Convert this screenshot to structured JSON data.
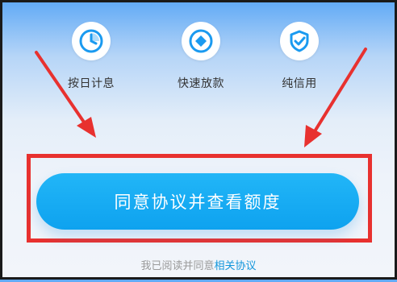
{
  "features": [
    {
      "label": "按日计息",
      "icon": "clock-icon"
    },
    {
      "label": "快速放款",
      "icon": "coin-icon"
    },
    {
      "label": "纯信用",
      "icon": "shield-check-icon"
    }
  ],
  "cta": {
    "label": "同意协议并查看额度"
  },
  "agreement": {
    "prefix": "我已阅读并同意",
    "link": "相关协议"
  },
  "colors": {
    "accent": "#0EA2EF",
    "highlight": "#E8312F",
    "icon": "#1A9AF0"
  }
}
